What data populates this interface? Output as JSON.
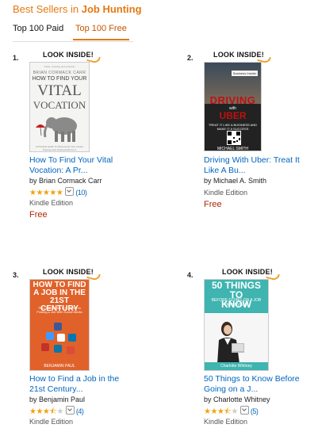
{
  "header": {
    "prefix": "Best Sellers in",
    "category": "Job Hunting"
  },
  "tabs": {
    "paid": "Top 100 Paid",
    "free": "Top 100 Free"
  },
  "look_inside": "LOOK INSIDE!",
  "colors": {
    "accent": "#e47911",
    "link": "#0066c0",
    "price": "#b12704",
    "star": "#f0a20d"
  },
  "items": [
    {
      "rank": "1.",
      "title_line1": "How To Find Your Vital",
      "title_line2": "Vocation: A Pr...",
      "author": "by Brian Cormack Carr",
      "rating": 5,
      "review_count": "(10)",
      "format": "Kindle Edition",
      "price": "Free",
      "cover": {
        "author": "BRIAN CORMACK CARR",
        "line1": "HOW TO FIND YOUR",
        "line2": "VITAL",
        "line3": "VOCATION"
      }
    },
    {
      "rank": "2.",
      "title_line1": "Driving With Uber: Treat It",
      "title_line2": "Like A Bu...",
      "author": "by Michael A. Smith",
      "format": "Kindle Edition",
      "price": "Free",
      "cover": {
        "line1": "DRIVING",
        "line2": "with",
        "line3": "UBER",
        "author": "MICHAEL SMITH"
      }
    },
    {
      "rank": "3.",
      "title_line1": "How to Find a Job in the",
      "title_line2": "21st Century...",
      "author": "by Benjamin Paul",
      "rating": 3.5,
      "review_count": "(4)",
      "format": "Kindle Edition",
      "cover": {
        "line1": "HOW TO FIND",
        "line2": "A JOB IN THE",
        "line3": "21ST CENTURY",
        "author": "BENJAMIN PAUL"
      }
    },
    {
      "rank": "4.",
      "title_line1": "50 Things to Know Before",
      "title_line2": "Going on a J...",
      "author": "by Charlotte Whitney",
      "rating": 3.5,
      "review_count": "(5)",
      "format": "Kindle Edition",
      "cover": {
        "line1": "50 THINGS TO",
        "line2": "KNOW",
        "line3": "BEFORE GOING ON A JOB INTERVIEW",
        "author": "Charlotte Whitney"
      }
    }
  ]
}
